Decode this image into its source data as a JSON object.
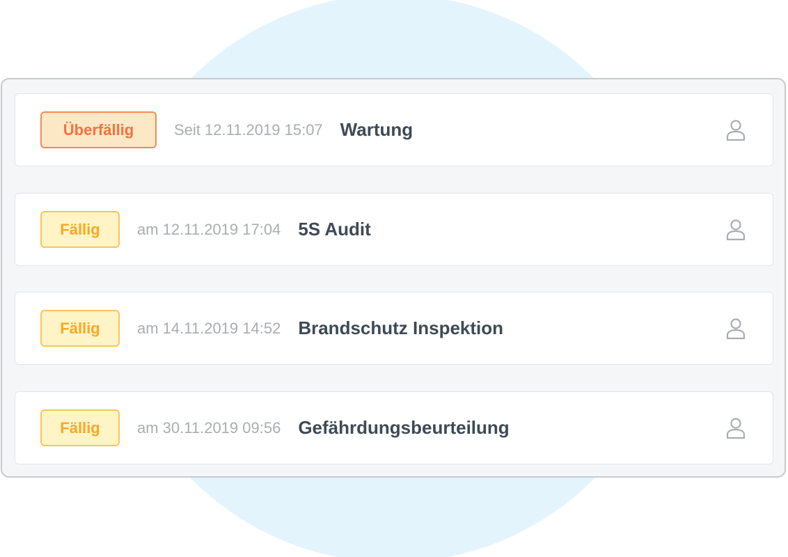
{
  "tasks": [
    {
      "status": "Überfällig",
      "status_type": "overdue",
      "date": "Seit 12.11.2019 15:07",
      "title": "Wartung",
      "assignee_icon": "user-icon"
    },
    {
      "status": "Fällig",
      "status_type": "due",
      "date": "am 12.11.2019 17:04",
      "title": "5S Audit",
      "assignee_icon": "user-icon"
    },
    {
      "status": "Fällig",
      "status_type": "due",
      "date": "am 14.11.2019 14:52",
      "title": "Brandschutz Inspektion",
      "assignee_icon": "user-icon"
    },
    {
      "status": "Fällig",
      "status_type": "due",
      "date": "am 30.11.2019 09:56",
      "title": "Gefährdungsbeurteilung",
      "assignee_icon": "user-icon"
    }
  ],
  "colors": {
    "overdue_text": "#f4723e",
    "overdue_border": "#f58a54",
    "overdue_bg": "#fde8c6",
    "due_text": "#f8a826",
    "due_border": "#fbc45c",
    "due_bg": "#fff4c6",
    "background_circle": "#e3f4fd"
  }
}
